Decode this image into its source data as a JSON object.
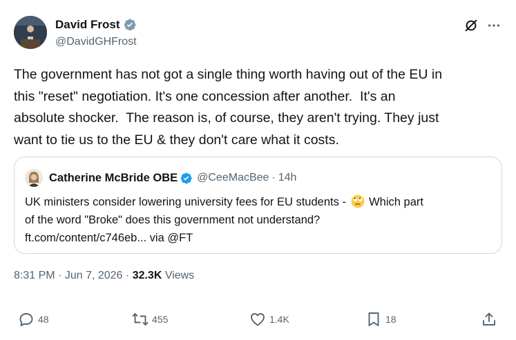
{
  "author": {
    "name": "David Frost",
    "handle": "@DavidGHFrost"
  },
  "tweet": {
    "text": "The government has not got a single thing worth having out of the EU in\nthis \"reset\" negotiation. It's one concession after another.  It's an\nabsolute shocker.  The reason is, of course, they aren't trying. They just\nwant to tie us to the EU & they don't care what it costs."
  },
  "quote": {
    "name": "Catherine McBride OBE",
    "handle": "@CeeMacBee",
    "separator": "·",
    "time": "14h",
    "text_before_emoji": "UK ministers consider lowering university fees for EU students - ",
    "text_after_emoji": " Which part\nof the word \"Broke\" does this government not understand?\nft.com/content/c746eb... via @FT",
    "emoji_name": "face-with-rolling-eyes"
  },
  "meta": {
    "time": "8:31 PM",
    "separator1": "·",
    "date": "Jun 7, 2026",
    "separator2": "·",
    "views_count": "32.3K",
    "views_label": "Views"
  },
  "actions": {
    "replies": "48",
    "reposts": "455",
    "likes": "1.4K",
    "bookmarks": "18"
  },
  "icons": {
    "verified": "verified-badge-icon",
    "grok": "grok-icon",
    "more": "more-options-icon",
    "reply": "reply-icon",
    "repost": "repost-icon",
    "like": "heart-icon",
    "bookmark": "bookmark-icon",
    "share": "share-icon"
  },
  "colors": {
    "text_primary": "#0f1419",
    "text_secondary": "#536471",
    "verified_blue": "#1d9bf0",
    "border": "#cfd9de"
  }
}
